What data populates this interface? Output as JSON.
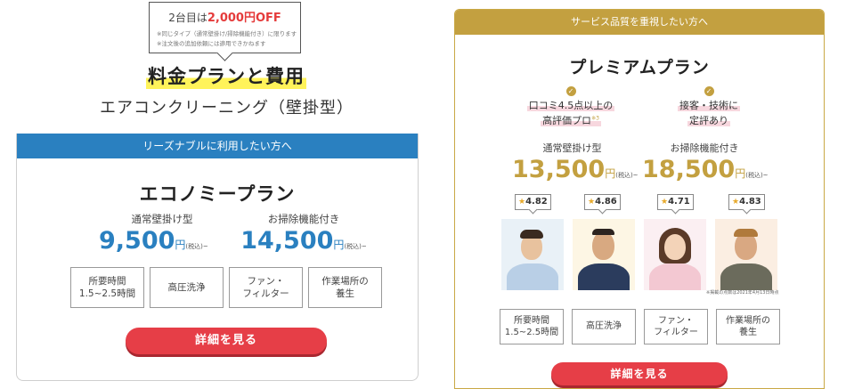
{
  "left": {
    "discount": {
      "prefix": "2台目は",
      "highlight": "2,000円OFF",
      "note1": "※同じタイプ（通常壁掛け/掃除機能付き）に限ります",
      "note2": "※注文後の追加依頼には適用できかねます"
    },
    "section_title": "料金プランと費用",
    "section_subtitle": "エアコンクリーニング（壁掛型）",
    "banner": "リーズナブルに利用したい方へ",
    "plan_name": "エコノミープラン",
    "prices": [
      {
        "label": "通常壁掛け型",
        "amount": "9,500",
        "yen": "円",
        "tax": "(税込)~"
      },
      {
        "label": "お掃除機能付き",
        "amount": "14,500",
        "yen": "円",
        "tax": "(税込)~"
      }
    ],
    "features": [
      "所要時間\n1.5~2.5時間",
      "高圧洗浄",
      "ファン・\nフィルター",
      "作業場所の\n養生"
    ],
    "cta": "詳細を見る"
  },
  "right": {
    "banner": "サービス品質を重視したい方へ",
    "plan_name": "プレミアムプラン",
    "merits": [
      {
        "line1": "口コミ4.5点以上の",
        "line2": "高評価プロ",
        "sup": "※3"
      },
      {
        "line1": "接客・技術に",
        "line2": "定評あり",
        "sup": ""
      }
    ],
    "prices": [
      {
        "label": "通常壁掛け型",
        "amount": "13,500",
        "yen": "円",
        "tax": "(税込)~"
      },
      {
        "label": "お掃除機能付き",
        "amount": "18,500",
        "yen": "円",
        "tax": "(税込)~"
      }
    ],
    "ratings": [
      "4.82",
      "4.86",
      "4.71",
      "4.83"
    ],
    "photo_note": "※掲載の点数は2021年4月13日時点",
    "features": [
      "所要時間\n1.5~2.5時間",
      "高圧洗浄",
      "ファン・\nフィルター",
      "作業場所の\n養生"
    ],
    "cta": "詳細を見る"
  },
  "colors": {
    "blue": "#2a80c0",
    "gold": "#c3a040",
    "cta_red": "#e63e47",
    "highlight_yellow": "#fff35a",
    "discount_red": "#e53b3b"
  }
}
